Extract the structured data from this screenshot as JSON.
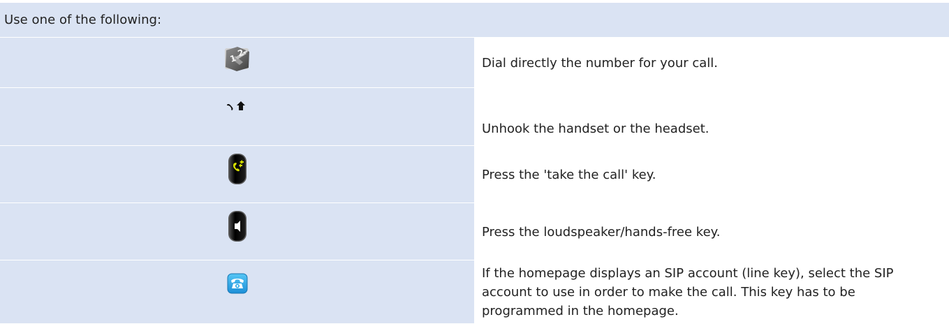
{
  "header": {
    "label": "Use one of the following:"
  },
  "rows": [
    {
      "icon": "dial-keypad-icon",
      "description": "Dial directly the number for your call."
    },
    {
      "icon": "handset-unhook-icon",
      "description": "Unhook the handset or the headset."
    },
    {
      "icon": "take-call-key-icon",
      "description": "Press the 'take the call' key."
    },
    {
      "icon": "loudspeaker-key-icon",
      "description": "Press the loudspeaker/hands-free key."
    },
    {
      "icon": "sip-line-key-icon",
      "description": "If the homepage displays an SIP account (line key), select the SIP account to use in order to make the call. This key has to be programmed in the homepage."
    }
  ],
  "colors": {
    "header_background": "#dae3f3",
    "take_call_accent": "#d6e000",
    "sip_blue": "#2ba9e8"
  }
}
